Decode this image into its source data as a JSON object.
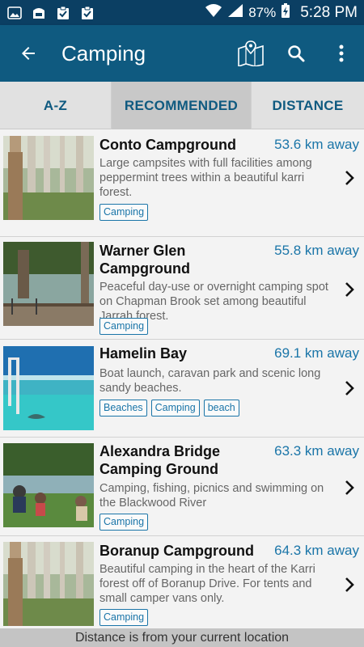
{
  "status_bar": {
    "battery": "87%",
    "time": "5:28 PM"
  },
  "app_bar": {
    "title": "Camping"
  },
  "tabs": [
    {
      "label": "A-Z"
    },
    {
      "label": "RECOMMENDED"
    },
    {
      "label": "DISTANCE"
    }
  ],
  "items": [
    {
      "title": "Conto Campground",
      "distance": "53.6 km away",
      "description": "Large campsites with full facilities among peppermint trees within a beautiful karri forest.",
      "tags": [
        "Camping"
      ]
    },
    {
      "title": "Warner Glen Campground",
      "distance": "55.8 km away",
      "description": "Peaceful day-use or overnight camping spot on Chapman Brook set among beautiful Jarrah forest.",
      "tags": [
        "Camping"
      ]
    },
    {
      "title": "Hamelin Bay",
      "distance": "69.1 km away",
      "description": "Boat launch, caravan park and scenic long sandy beaches.",
      "tags": [
        "Beaches",
        "Camping",
        "beach"
      ]
    },
    {
      "title": "Alexandra Bridge Camping Ground",
      "distance": "63.3 km away",
      "description": "Camping, fishing, picnics and swimming on the Blackwood River",
      "tags": [
        "Camping"
      ]
    },
    {
      "title": "Boranup Campground",
      "distance": "64.3 km away",
      "description": "Beautiful camping in the heart of the Karri forest off of Boranup Drive. For tents and small camper vans only.",
      "tags": [
        "Camping"
      ]
    }
  ],
  "footer": {
    "text": "Distance is from your current location"
  }
}
